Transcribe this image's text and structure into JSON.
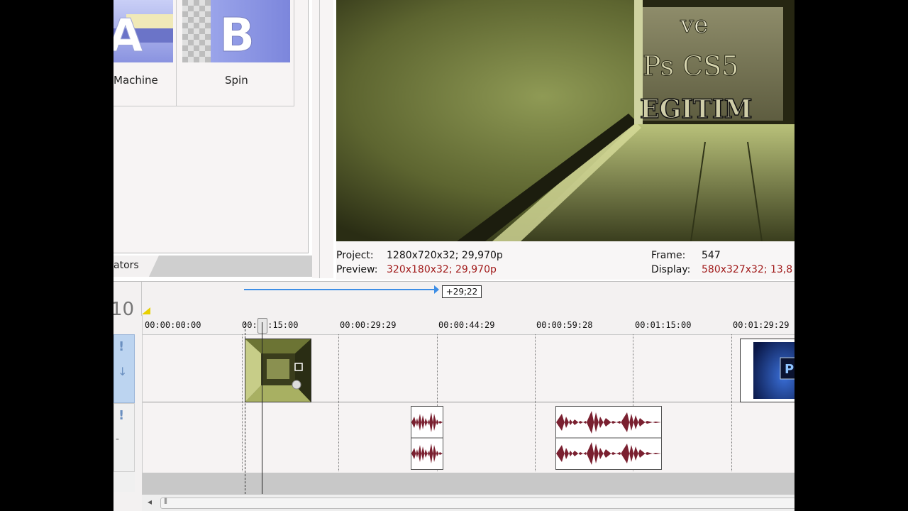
{
  "transitions": {
    "items": [
      {
        "label": "Machine",
        "thumb_glyph": "A"
      },
      {
        "label": "Spin",
        "thumb_glyph": "B"
      }
    ],
    "tab_label": "ators"
  },
  "preview": {
    "overlay_lines": [
      "ve",
      "Ps CS5",
      "EGITIM"
    ],
    "project_label": "Project:",
    "project_value": "1280x720x32; 29,970p",
    "preview_label": "Preview:",
    "preview_value": "320x180x32; 29,970p",
    "frame_label": "Frame:",
    "frame_value": "547",
    "display_label": "Display:",
    "display_value": "580x327x32; 13,8"
  },
  "timeline": {
    "track_number": "10",
    "selection_delta": "+29;22",
    "ruler_labels": [
      "00:00:00:00",
      "00:00:15:00",
      "00:00:29:29",
      "00:00:44:29",
      "00:00:59:28",
      "00:01:15:00",
      "00:01:29:29"
    ],
    "thumb_label": "P"
  },
  "colors": {
    "waveform": "#7a2030",
    "selection_line": "#3d8ee6",
    "header_blue": "#bcd4f0"
  }
}
